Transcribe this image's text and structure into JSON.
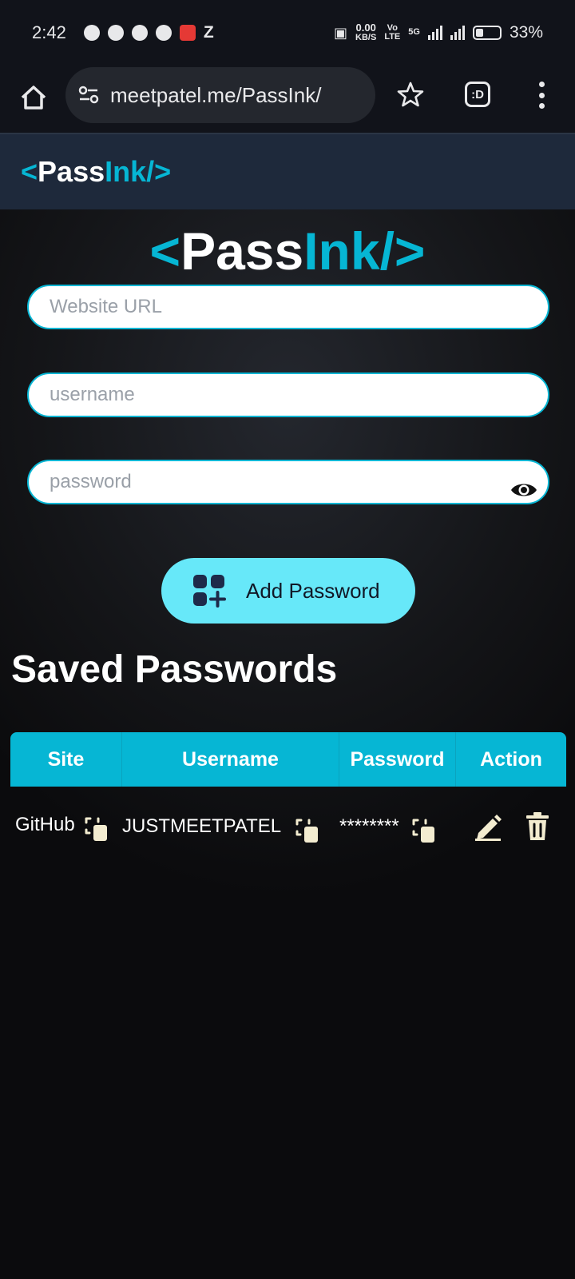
{
  "status_bar": {
    "time": "2:42",
    "app_letter": "Z",
    "net_speed_value": "0.00",
    "net_speed_unit": "KB/S",
    "volte_top": "Vo",
    "volte_bottom": "LTE",
    "network": "5G",
    "battery": "33%"
  },
  "browser": {
    "url": "meetpatel.me/PassInk/",
    "tabs_label": ":D"
  },
  "site_nav": {
    "logo_open": "<",
    "logo_pass": "Pass",
    "logo_ink": "Ink",
    "logo_close": "/>"
  },
  "hero_logo": {
    "open": "<",
    "pass": "Pass",
    "ink": "Ink",
    "close": "/>"
  },
  "form": {
    "website_placeholder": "Website URL",
    "username_placeholder": "username",
    "password_placeholder": "password",
    "add_button_label": "Add Password"
  },
  "saved": {
    "title": "Saved Passwords",
    "columns": [
      "Site",
      "Username",
      "Password",
      "Action"
    ],
    "rows": [
      {
        "site": "GitHub",
        "username": "JUSTMEETPATEL",
        "password": "********"
      }
    ]
  },
  "colors": {
    "accent": "#06b6d4",
    "button": "#67e8f9",
    "nav_bg": "#1e293b",
    "icon_cream": "#f3ecd0"
  }
}
